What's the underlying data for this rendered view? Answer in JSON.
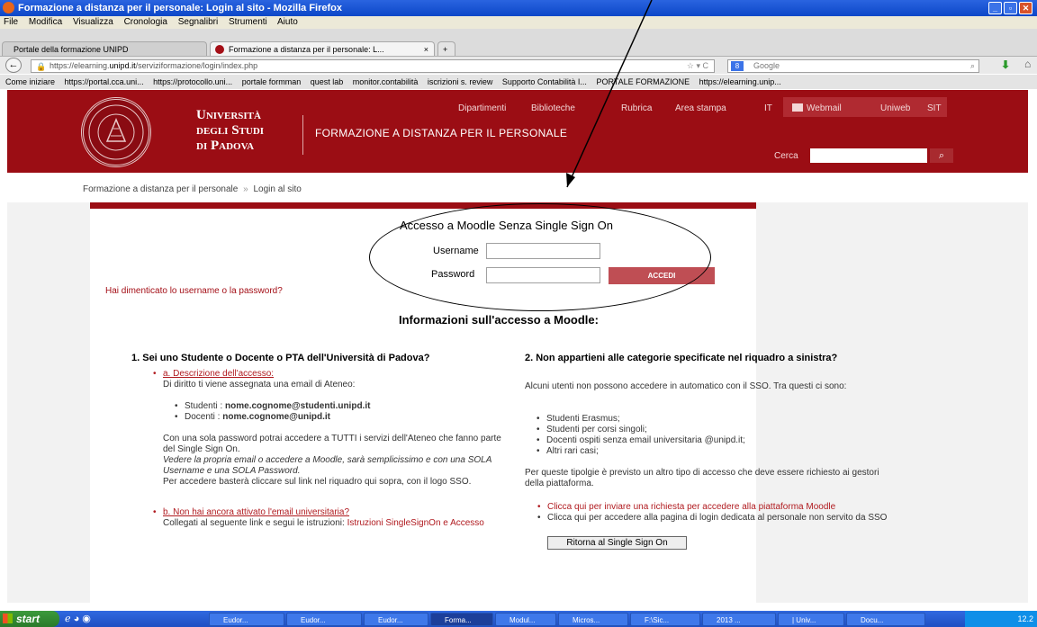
{
  "window": {
    "title": "Formazione a distanza per il personale: Login al sito - Mozilla Firefox",
    "menu": [
      "File",
      "Modifica",
      "Visualizza",
      "Cronologia",
      "Segnalibri",
      "Strumenti",
      "Aiuto"
    ],
    "tabs": [
      "Portale della formazione UNIPD",
      "Formazione a distanza per il personale: L..."
    ],
    "new_tab": "+",
    "url_prefix": "https://elearning.",
    "url_domain": "unipd.it",
    "url_path": "/serviziformazione/login/index.php",
    "search_placeholder": "Google",
    "bookmarks": [
      "Come iniziare",
      "https://portal.cca.uni...",
      "https://protocollo.uni...",
      "portale formman",
      "quest lab",
      "monitor.contabilità",
      "iscrizioni s. review",
      "Supporto Contabilità I...",
      "PORTALE FORMAZIONE",
      "https://elearning.unip..."
    ]
  },
  "header": {
    "uni_line1": "Università",
    "uni_line2": "degli Studi",
    "uni_line3": "di Padova",
    "site_name": "FORMAZIONE A DISTANZA PER IL PERSONALE",
    "links": [
      "Dipartimenti",
      "Biblioteche",
      "Rubrica",
      "Area stampa",
      "IT",
      "Webmail",
      "Uniweb",
      "SIT"
    ],
    "search_label": "Cerca"
  },
  "breadcrumb": {
    "home": "Formazione a distanza per il personale",
    "sep": "»",
    "current": "Login al sito"
  },
  "login": {
    "title": "Accesso a Moodle Senza Single Sign On",
    "username_label": "Username",
    "password_label": "Password",
    "submit_label": "ACCEDI",
    "forgot": "Hai dimenticato lo username o la password?"
  },
  "info": {
    "title": "Informazioni sull'accesso a Moodle:",
    "left": {
      "heading": "1. Sei uno Studente o Docente o PTA dell'Università di Padova?",
      "a_link": "a. Descrizione dell'accesso:",
      "a_text": "Di diritto ti viene assegnata una email di Ateneo:",
      "students_label": "Studenti : ",
      "students_email": "nome.cognome@studenti.unipd.it",
      "teachers_label": "Docenti : ",
      "teachers_email": "nome.cognome@unipd.it",
      "p1": "Con una sola password potrai accedere a TUTTI i servizi dell'Ateneo che fanno parte del Single Sign On.",
      "p2": "Vedere la propria email o accedere a Moodle, sarà semplicissimo e con una SOLA Username e una SOLA Password.",
      "p3": "Per accedere basterà cliccare sul link nel riquadro qui sopra, con il logo SSO.",
      "b_link": "b. Non hai ancora attivato l'email universitaria?",
      "b_text": "Collegati al seguente link e segui le istruzioni: ",
      "b_link2": "Istruzioni SingleSignOn e Accesso"
    },
    "right": {
      "heading": "2. Non appartieni alle categorie specificate nel riquadro a sinistra?",
      "p1": "Alcuni utenti non possono accedere in automatico con il SSO. Tra questi ci sono:",
      "items": [
        "Studenti Erasmus;",
        "Studenti per corsi singoli;",
        "Docenti ospiti senza email universitaria @unipd.it;",
        "Altri rari casi;"
      ],
      "p2": "Per queste tipolgie è previsto un altro tipo di accesso che deve essere richiesto ai gestori della piattaforma.",
      "link1": "Clicca qui per inviare una richiesta per accedere alla piattaforma Moodle",
      "link2": "Clicca qui per accedere alla pagina di login dedicata al personale non servito da SSO",
      "button": "Ritorna al Single Sign On"
    }
  },
  "taskbar": {
    "start": "start",
    "tasks": [
      "Eudor...",
      "Eudor...",
      "Eudor...",
      "Forma...",
      "Modul...",
      "Micros...",
      "F:\\Sic...",
      "2013 ...",
      "| Univ...",
      "Docu..."
    ],
    "clock": "12.2"
  },
  "colors": {
    "brand": "#9b0d14",
    "link": "#a40f17",
    "button": "#bf4e54"
  }
}
